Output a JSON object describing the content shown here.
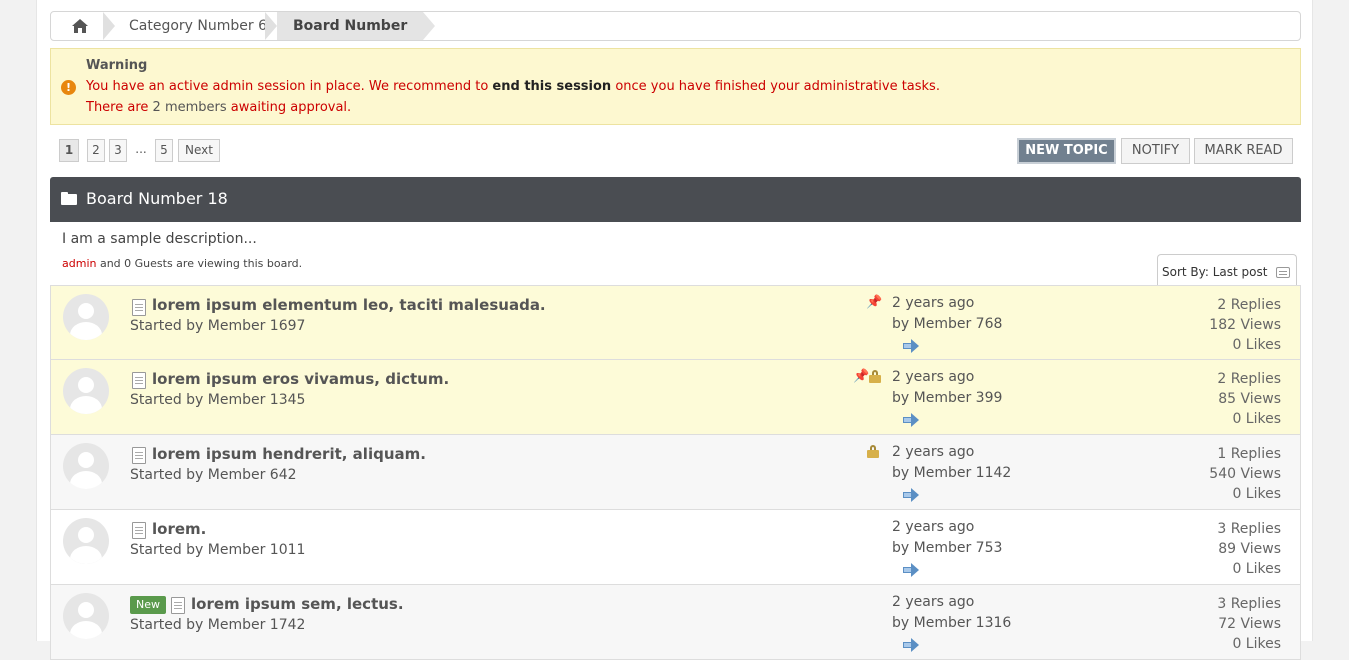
{
  "breadcrumb": {
    "home_icon": "home-icon",
    "category": "Category Number 6",
    "board": "Board Number 18"
  },
  "warning": {
    "title": "Warning",
    "line1_pre": "You have an active admin session in place. We recommend to ",
    "line1_bold": "end this session",
    "line1_post": " once you have finished your administrative tasks.",
    "line2_pre": "There are ",
    "line2_count": "2",
    "line2_mid": " members ",
    "line2_link": "awaiting approval",
    "line2_post": "."
  },
  "pagination": {
    "pages": [
      "1",
      "2",
      "3",
      "...",
      "5"
    ],
    "next": "Next"
  },
  "actions": {
    "new_topic": "NEW TOPIC",
    "notify": "NOTIFY",
    "mark_read": "MARK READ"
  },
  "board": {
    "title": "Board Number 18",
    "description": "I am a sample description...",
    "viewing_user": "admin",
    "viewing_rest": " and 0 Guests are viewing this board."
  },
  "sort": {
    "label": "Sort By: Last post"
  },
  "topics": [
    {
      "subject": "lorem ipsum elementum leo, taciti malesuada.",
      "started": "Started by Member 1697",
      "last_time": "2 years ago",
      "last_by": "by Member 768",
      "replies": "2 Replies",
      "views": "182 Views",
      "likes": "0 Likes"
    },
    {
      "subject": "lorem ipsum eros vivamus, dictum.",
      "started": "Started by Member 1345",
      "last_time": "2 years ago",
      "last_by": "by Member 399",
      "replies": "2 Replies",
      "views": "85 Views",
      "likes": "0 Likes"
    },
    {
      "subject": "lorem ipsum hendrerit, aliquam.",
      "started": "Started by Member 642",
      "last_time": "2 years ago",
      "last_by": "by Member 1142",
      "replies": "1 Replies",
      "views": "540 Views",
      "likes": "0 Likes"
    },
    {
      "subject": "lorem.",
      "started": "Started by Member 1011",
      "last_time": "2 years ago",
      "last_by": "by Member 753",
      "replies": "3 Replies",
      "views": "89 Views",
      "likes": "0 Likes"
    },
    {
      "badge": "New",
      "subject": "lorem ipsum sem, lectus.",
      "started": "Started by Member 1742",
      "last_time": "2 years ago",
      "last_by": "by Member 1316",
      "replies": "3 Replies",
      "views": "72 Views",
      "likes": "0 Likes"
    }
  ],
  "colors": {
    "warning_bg": "#fdf8d0",
    "warning_text": "#cc0000",
    "sticky_bg": "#fdfbd8",
    "header_bg": "#4a4d52",
    "primary_button": "#71808f",
    "new_badge": "#5a9a4c"
  }
}
